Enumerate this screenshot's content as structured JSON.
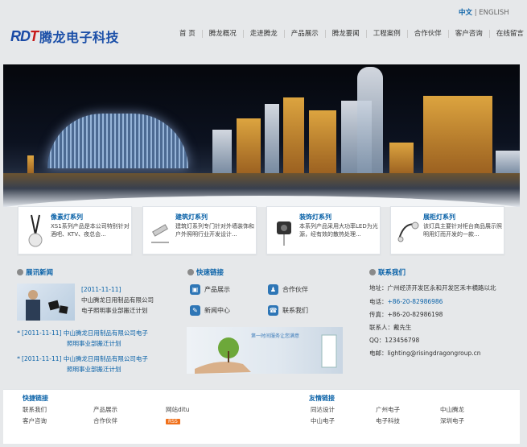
{
  "header": {
    "lang_cn": "中文",
    "lang_sep": "|",
    "lang_en": "ENGLISH",
    "logo_mark_a": "RD",
    "logo_mark_b": "T",
    "company_name": "腾龙电子科技"
  },
  "nav": [
    "首 页",
    "腾龙概况",
    "走进腾龙",
    "产品展示",
    "腾龙要闻",
    "工程案例",
    "合作伙伴",
    "客户咨询",
    "在线留言"
  ],
  "products": [
    {
      "title": "像素灯系列",
      "desc": "XS1系列产品是本公司特别针对酒吧、KTV、夜总会..."
    },
    {
      "title": "建筑灯系列",
      "desc": "建筑灯系列专门针对外墙装饰和户外照明行业开发设计..."
    },
    {
      "title": "装饰灯系列",
      "desc": "本系列产品采用大功率LED为光源，经有效的散热处理..."
    },
    {
      "title": "展柜灯系列",
      "desc": "该灯具主要针对柜台商品展示照明用灯而开发的一款..."
    }
  ],
  "sections": {
    "news": "展讯新闻",
    "quick": "快速链接",
    "contact": "联系我们"
  },
  "news": {
    "featured_date": "[2011-11-11]",
    "featured_text_1": "中山腾龙日用制品有限公司",
    "featured_text_2": "电子照明事业部搬迁计划",
    "items": [
      {
        "line1": "[2011-11-11] 中山腾龙日用制品有限公司电子",
        "line2": "照明事业部搬迁计划"
      },
      {
        "line1": "[2011-11-11] 中山腾龙日用制品有限公司电子",
        "line2": "照明事业部搬迁计划"
      }
    ]
  },
  "quick_links": [
    "产品展示",
    "合作伙伴",
    "新闻中心",
    "联系我们"
  ],
  "quick_banner": "第一时间服务让您满意",
  "contact": {
    "address": "地址：广州经济开发区永和开发区禾丰横路以北",
    "phone_label": "电话：",
    "phone": "+86-20-82986986",
    "fax": "传真：+86-20-82986198",
    "person": "联系人：戴先生",
    "qq": "QQ：123456798",
    "email": "电邮：lighting@risingdragongroup.cn"
  },
  "footer": {
    "quick_title": "快捷链接",
    "quick_links": [
      "联系我们",
      "产品展示",
      "网站ditu",
      "客户咨询",
      "合作伙伴"
    ],
    "rss": "RSS",
    "friend_title": "友情链接",
    "friend_links": [
      "同达设计",
      "广州电子",
      "中山腾龙",
      "中山电子",
      "电子科技",
      "深圳电子"
    ]
  }
}
